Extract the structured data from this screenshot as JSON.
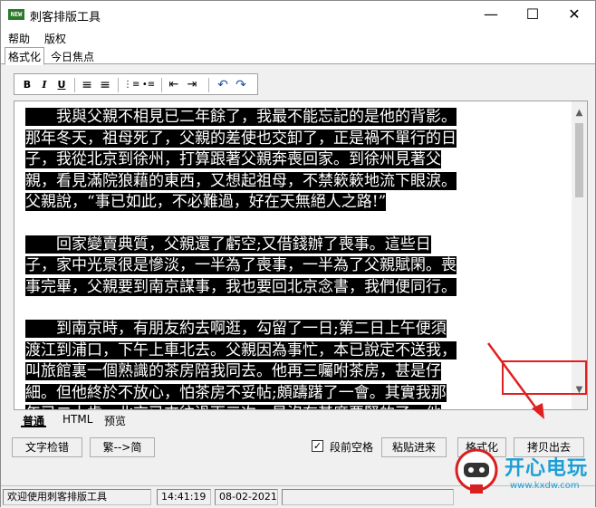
{
  "window": {
    "title": "刺客排版工具",
    "icon_text": "NEW",
    "minimize": "—",
    "maximize": "☐",
    "close": "✕"
  },
  "menu": [
    {
      "label": "帮助"
    },
    {
      "label": "版权"
    }
  ],
  "top_tabs": [
    {
      "label": "格式化",
      "active": true
    },
    {
      "label": "今日焦点",
      "active": false
    }
  ],
  "toolbar": {
    "bold": "B",
    "italic": "I",
    "underline": "U",
    "align_left": "≡",
    "align_justify": "≡",
    "numbered_list": "⋮≡",
    "bullet_list": "•≡",
    "outdent": "⇤",
    "indent": "⇥",
    "undo": "↶",
    "redo": "↷"
  },
  "editor": {
    "paragraphs": [
      [
        "　　我與父親不相見已二年餘了，我最不能忘記的是他的背影。",
        "那年冬天，祖母死了，父親的差使也交卸了，正是禍不單行的日",
        "子，我從北京到徐州，打算跟著父親奔喪回家。到徐州見著父",
        "親，看見滿院狼藉的東西，又想起祖母，不禁簌簌地流下眼淚。",
        "父親說，“事已如此，不必難過，好在天無絕人之路!”"
      ],
      [
        "　　回家變賣典質，父親還了虧空;又借錢辦了喪事。這些日",
        "子，家中光景很是慘淡，一半為了喪事，一半為了父親賦閑。喪",
        "事完畢，父親要到南京謀事，我也要回北京念書，我們便同行。"
      ],
      [
        "　　到南京時，有朋友約去啊逛，勾留了一日;第二日上午便須",
        "渡江到浦口，下午上車北去。父親因為事忙，本已說定不送我，",
        "叫旅館裏一個熟識的茶房陪我同去。他再三囑咐茶房，甚是仔",
        "細。但他終於不放心，怕茶房不妥帖;頗躊躇了一會。其實我那",
        "年已二十歲，北京已來往過兩三次，是沒有甚麼要緊的了。他"
      ]
    ]
  },
  "bottom_tabs": [
    {
      "label": "普通",
      "active": true
    },
    {
      "label": "HTML",
      "active": false
    },
    {
      "label": "预览",
      "active": false
    }
  ],
  "actions": {
    "text_check": "文字检错",
    "convert": "繁-->简",
    "indent_option": "段前空格",
    "indent_checked": true,
    "paste_in": "粘贴进来",
    "format": "格式化",
    "copy_out": "拷贝出去"
  },
  "status": {
    "welcome": "欢迎使用刺客排版工具",
    "time": "14:41:19",
    "date": "08-02-2021"
  },
  "watermark": {
    "brand": "开心电玩",
    "url": "www.kxdw.com"
  },
  "colors": {
    "highlight": "#e02020",
    "brand": "#1c9fd8"
  }
}
